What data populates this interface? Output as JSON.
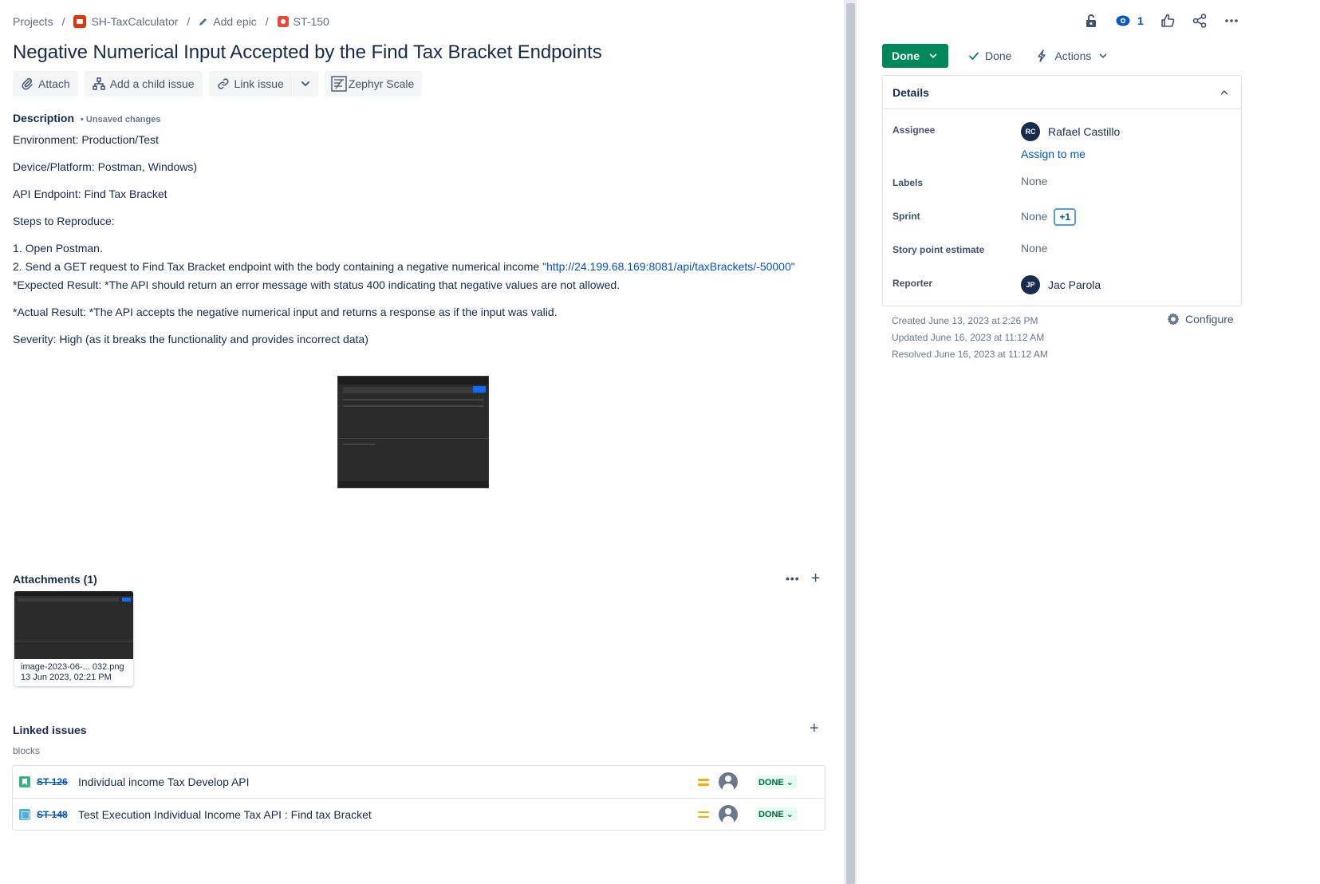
{
  "breadcrumb": {
    "projects": "Projects",
    "project": "SH-TaxCalculator",
    "epic": "Add epic",
    "issue": "ST-150"
  },
  "issue": {
    "title": "Negative Numerical Input Accepted by the Find Tax Bracket Endpoints"
  },
  "toolbar": {
    "attach": "Attach",
    "add_child": "Add a child issue",
    "link_issue": "Link issue",
    "zephyr": "Zephyr Scale"
  },
  "description": {
    "heading": "Description",
    "unsaved": "• Unsaved changes",
    "environment": "Environment: Production/Test",
    "device": "Device/Platform: Postman, Windows)",
    "endpoint": "API Endpoint: Find Tax Bracket",
    "steps_label": "Steps to Reproduce:",
    "step1": "1. Open Postman.",
    "step2_text": "2. Send a GET request to Find Tax Bracket endpoint with the body containing a negative numerical income ",
    "step2_link": "\"http://24.199.68.169:8081/api/taxBrackets/-50000\"",
    "expected": "*Expected Result: *The API should return an error message with status 400 indicating that negative values are not allowed.",
    "actual": "*Actual Result: *The API accepts the negative numerical input and returns a response as if the input was valid.",
    "severity": "Severity: High (as it breaks the functionality and provides incorrect data)"
  },
  "attachments": {
    "heading": "Attachments (1)",
    "items": [
      {
        "name": "image-2023-06-... 032.png",
        "date": "13 Jun 2023, 02:21 PM"
      }
    ]
  },
  "linked": {
    "heading": "Linked issues",
    "relation": "blocks",
    "items": [
      {
        "key": "ST-126",
        "summary": "Individual income Tax Develop API",
        "status": "DONE"
      },
      {
        "key": "ST-148",
        "summary": "Test Execution Individual Income Tax API : Find tax Bracket",
        "status": "DONE"
      }
    ]
  },
  "header_right": {
    "watch_count": "1"
  },
  "status": {
    "button": "Done",
    "resolution": "Done",
    "actions": "Actions"
  },
  "details": {
    "heading": "Details",
    "assignee_label": "Assignee",
    "assignee_initials": "RC",
    "assignee_name": "Rafael Castillo",
    "assign_to_me": "Assign to me",
    "labels_label": "Labels",
    "labels_value": "None",
    "sprint_label": "Sprint",
    "sprint_value": "None",
    "sprint_extra": "+1",
    "story_label": "Story point estimate",
    "story_value": "None",
    "reporter_label": "Reporter",
    "reporter_initials": "JP",
    "reporter_name": "Jac Parola"
  },
  "meta": {
    "created": "Created June 13, 2023 at 2:26 PM",
    "updated": "Updated June 16, 2023 at 11:12 AM",
    "resolved": "Resolved June 16, 2023 at 11:12 AM",
    "configure": "Configure"
  },
  "colors": {
    "primary": "#0052cc",
    "done_green": "#00875a",
    "text": "#172b4d",
    "priority_medium": "#ffab00"
  },
  "icons": [
    "pencil-icon",
    "paperclip-icon",
    "hierarchy-icon",
    "link-icon",
    "chevron-down-icon",
    "zephyr-icon",
    "lock-icon",
    "eye-icon",
    "thumbs-up-icon",
    "share-icon",
    "more-icon",
    "check-icon",
    "lightning-icon",
    "chevron-up-icon",
    "gear-icon",
    "plus-icon",
    "story-icon",
    "test-icon",
    "priority-medium-icon",
    "user-avatar-icon"
  ]
}
